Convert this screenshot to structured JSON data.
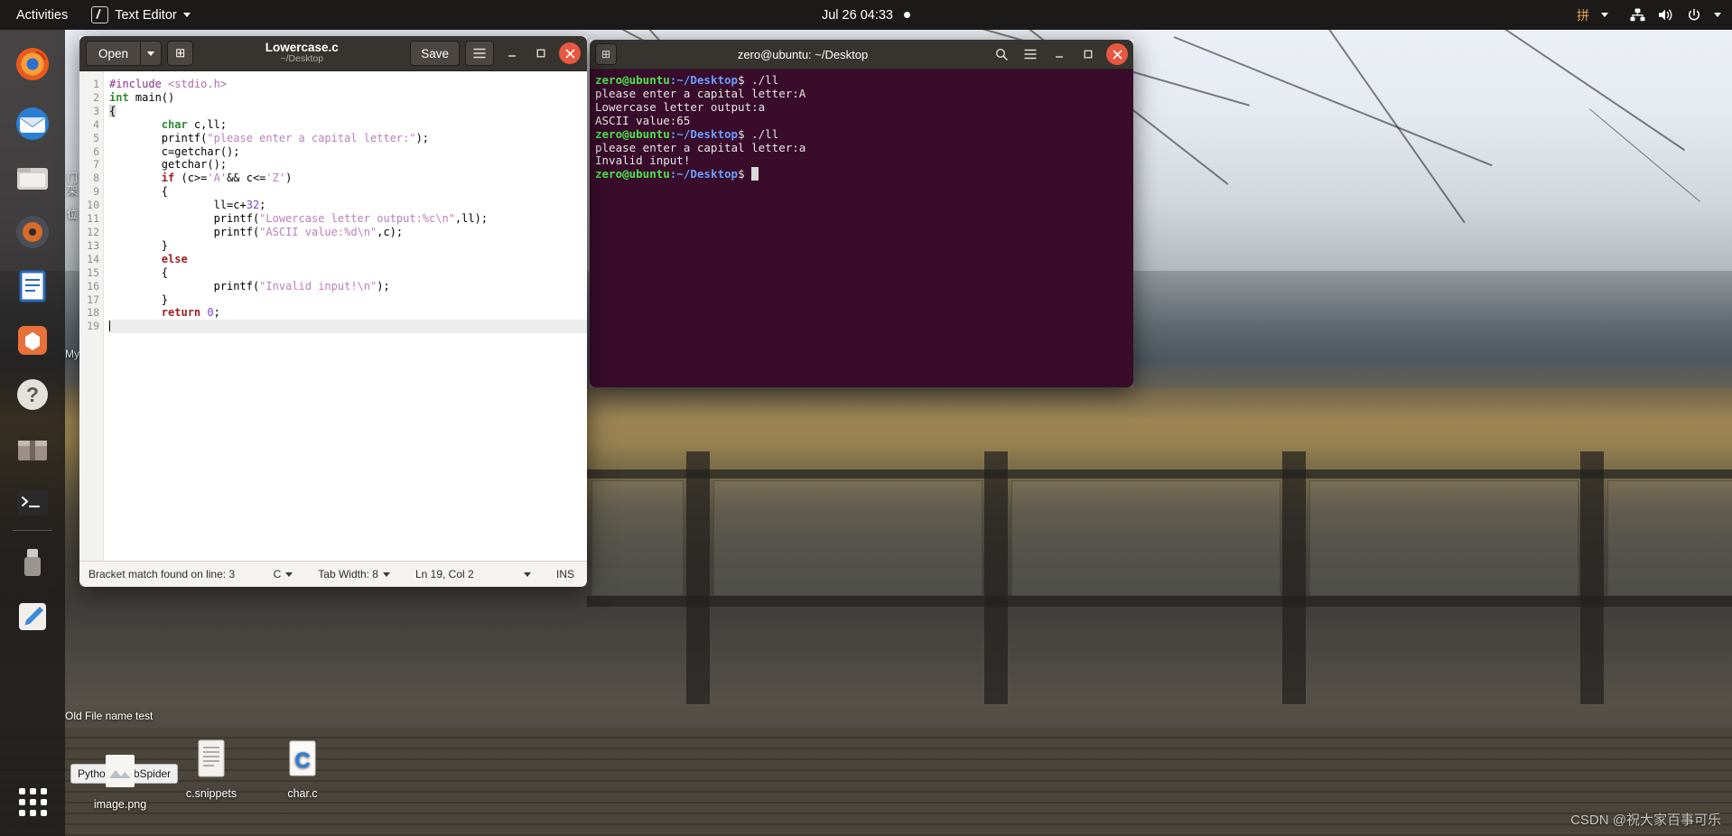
{
  "topbar": {
    "activities": "Activities",
    "app_menu": "Text Editor",
    "app_icon": "text-editor-icon",
    "clock": "Jul 26  04:33",
    "notification_dot": "•",
    "ime_label": "拼",
    "network_icon": "network-icon",
    "volume_icon": "volume-icon",
    "power_icon": "power-icon",
    "caret_icon": "chevron-down-icon"
  },
  "dock": {
    "items": [
      {
        "name": "firefox",
        "label": "Firefox"
      },
      {
        "name": "thunderbird",
        "label": "Thunderbird"
      },
      {
        "name": "files",
        "label": "Files"
      },
      {
        "name": "rhythmbox",
        "label": "Rhythmbox"
      },
      {
        "name": "libreoffice-writer",
        "label": "LibreOffice Writer"
      },
      {
        "name": "ubuntu-software",
        "label": "Ubuntu Software"
      },
      {
        "name": "help",
        "label": "Help"
      },
      {
        "name": "archive-manager",
        "label": "Archive Manager"
      },
      {
        "name": "terminal",
        "label": "Terminal"
      },
      {
        "name": "usb-drive",
        "label": "USB Drive"
      },
      {
        "name": "text-editor",
        "label": "Text Editor"
      }
    ],
    "show_apps_label": "Show Applications"
  },
  "desktop": {
    "icons": [
      {
        "name": "image-png",
        "label": "image.png"
      },
      {
        "name": "c-snippets",
        "label": "c.snippets"
      },
      {
        "name": "char-c",
        "label": "char.c"
      }
    ],
    "tooltip": "Python3WebSpider",
    "partial_label": "Old File name test",
    "side_text_1": "门架",
    "side_text_2": "位",
    "side_label": "MyJa",
    "watermark": "CSDN @祝大家百事可乐"
  },
  "editor": {
    "open_label": "Open",
    "open_caret_icon": "chevron-down-icon",
    "new_tab_icon": "new-tab-icon",
    "title": "Lowercase.c",
    "subtitle": "~/Desktop",
    "save_label": "Save",
    "menu_icon": "hamburger-menu-icon",
    "minimize_icon": "minimize-icon",
    "maximize_icon": "maximize-icon",
    "close_icon": "close-icon",
    "line_numbers": [
      "1",
      "2",
      "3",
      "4",
      "5",
      "6",
      "7",
      "8",
      "9",
      "10",
      "11",
      "12",
      "13",
      "14",
      "15",
      "16",
      "17",
      "18",
      "19"
    ],
    "statusbar": {
      "message": "Bracket match found on line: 3",
      "language": "C",
      "tab_width": "Tab Width: 8",
      "position": "Ln 19, Col 2",
      "insert_mode": "INS"
    },
    "code_lines": [
      "#include <stdio.h>",
      "int main()",
      "{",
      "        char c,ll;",
      "        printf(\"please enter a capital letter:\");",
      "        c=getchar();",
      "        getchar();",
      "        if (c>='A'&& c<='Z')",
      "        {",
      "                ll=c+32;",
      "                printf(\"Lowercase letter output:%c\\n\",ll);",
      "                printf(\"ASCII value:%d\\n\",c);",
      "        }",
      "        else",
      "        {",
      "                printf(\"Invalid input!\\n\");",
      "        }",
      "        return 0;",
      ""
    ]
  },
  "terminal": {
    "title": "zero@ubuntu: ~/Desktop",
    "new_tab_icon": "new-tab-icon",
    "search_icon": "search-icon",
    "menu_icon": "hamburger-menu-icon",
    "minimize_icon": "minimize-icon",
    "maximize_icon": "maximize-icon",
    "close_icon": "close-icon",
    "prompt_user": "zero@ubuntu",
    "prompt_path": ":~/Desktop",
    "prompt_tail": "$ ",
    "lines": [
      {
        "type": "prompt",
        "command": "./ll"
      },
      {
        "type": "out",
        "text": "please enter a capital letter:A"
      },
      {
        "type": "out",
        "text": "Lowercase letter output:a"
      },
      {
        "type": "out",
        "text": "ASCII value:65"
      },
      {
        "type": "prompt",
        "command": "./ll"
      },
      {
        "type": "out",
        "text": "please enter a capital letter:a"
      },
      {
        "type": "out",
        "text": "Invalid input!"
      },
      {
        "type": "prompt_cursor",
        "command": ""
      }
    ]
  }
}
